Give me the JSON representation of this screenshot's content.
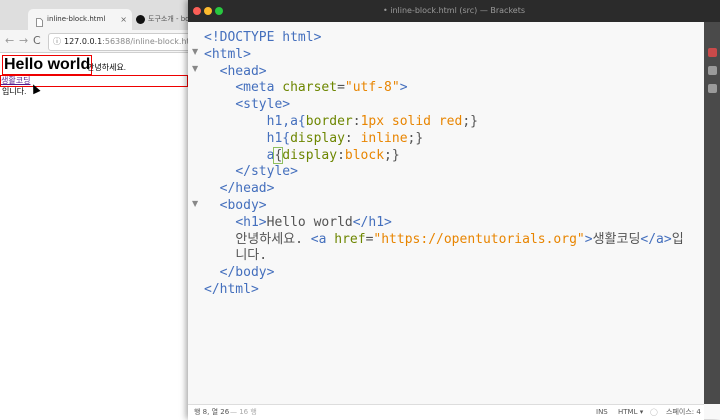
{
  "browser": {
    "tabs": [
      {
        "label": "inline-block.html",
        "close": "×",
        "active": true
      },
      {
        "label": "도구소개 - bo",
        "active": false
      }
    ],
    "nav": {
      "back": "←",
      "forward": "→",
      "reload": "C"
    },
    "address": {
      "info_icon": "ⓘ",
      "host": "127.0.0.1",
      "path": ":56388/inline-block.html"
    },
    "page": {
      "heading": "Hello world",
      "text_after_heading": "안녕하세요.",
      "link_text": "생활코딩",
      "text_after_link": "입니다."
    }
  },
  "editor": {
    "window_title": "• inline-block.html (src) — Brackets",
    "fold_markers": [
      "▼",
      "▼",
      "▼"
    ],
    "code": {
      "l1": "<!DOCTYPE html>",
      "l2_tag": "<html>",
      "l3_tag": "<head>",
      "l4_tag_open": "<meta",
      "l4_attr": "charset",
      "l4_eq": "=",
      "l4_val": "\"utf-8\"",
      "l4_tag_close": ">",
      "l5_tag": "<style>",
      "l6_sel": "h1,a{",
      "l6_prop": "border",
      "l6_colon": ":",
      "l6_val": "1px solid red",
      "l6_end": ";}",
      "l7_sel": "h1{",
      "l7_prop": "display",
      "l7_colon": ": ",
      "l7_val": "inline",
      "l7_end": ";}",
      "l8_sel": "a",
      "l8_brace": "{",
      "l8_prop": "display",
      "l8_colon": ":",
      "l8_val": "block",
      "l8_end": ";}",
      "l9_tag": "</style>",
      "l10_tag": "</head>",
      "l11_tag": "<body>",
      "l12_open": "<h1>",
      "l12_text": "Hello world",
      "l12_close": "</h1>",
      "l13_text": "안녕하세요. ",
      "l13_a_open": "<a",
      "l13_attr": "href",
      "l13_eq": "=",
      "l13_val": "\"https://opentutorials.org\"",
      "l13_gt": ">",
      "l13_link": "생활코딩",
      "l13_a_close": "</a>",
      "l13_tail": "입",
      "l14_text": "니다.",
      "l15_tag": "</body>",
      "l16_tag": "</html>"
    },
    "status": {
      "cursor": "행 8, 열 26",
      "lines": "— 16 행",
      "mode": "INS",
      "language": "HTML ▾",
      "spaces": "스페이스: 4"
    }
  },
  "colors": {
    "tag": "#446fbd",
    "attribute": "#6d8600",
    "value": "#e88501",
    "border_red": "#e00000"
  }
}
